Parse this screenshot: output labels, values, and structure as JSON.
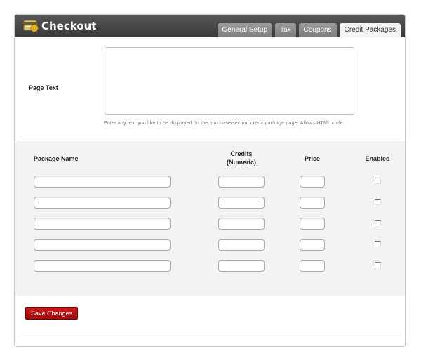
{
  "header": {
    "title": "Checkout",
    "icon": "checkout-icon"
  },
  "tabs": [
    {
      "label": "General Setup",
      "active": false
    },
    {
      "label": "Tax",
      "active": false
    },
    {
      "label": "Coupons",
      "active": false
    },
    {
      "label": "Credit Packages",
      "active": true
    }
  ],
  "page_text": {
    "label": "Page Text",
    "value": "",
    "help": "Enter any text you like to be displayed on the purchase/section credit package page. Allows HTML code."
  },
  "packages": {
    "headers": {
      "name": "Package Name",
      "credits_line1": "Credits",
      "credits_line2": "(Numeric)",
      "price": "Price",
      "enabled": "Enabled"
    },
    "rows": [
      {
        "name": "",
        "credits": "",
        "price": "",
        "enabled": false
      },
      {
        "name": "",
        "credits": "",
        "price": "",
        "enabled": false
      },
      {
        "name": "",
        "credits": "",
        "price": "",
        "enabled": false
      },
      {
        "name": "",
        "credits": "",
        "price": "",
        "enabled": false
      },
      {
        "name": "",
        "credits": "",
        "price": "",
        "enabled": false
      }
    ]
  },
  "actions": {
    "save_label": "Save Changes"
  },
  "colors": {
    "accent_red": "#b31010",
    "header_dark": "#454545"
  }
}
